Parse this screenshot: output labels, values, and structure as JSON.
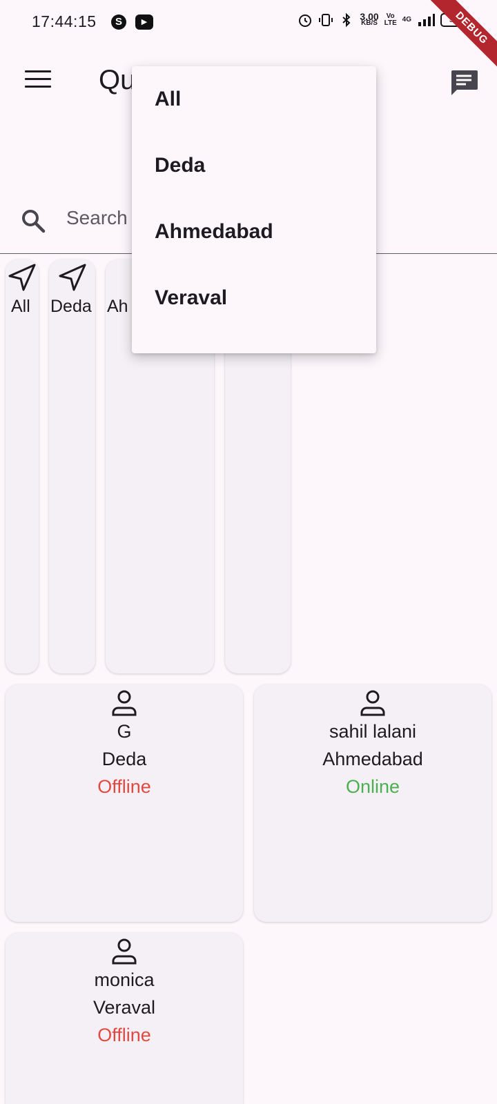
{
  "status_bar": {
    "time": "17:44:15",
    "apps": [
      "S",
      "▶"
    ],
    "speed_value": "3.00",
    "speed_unit": "KB/S",
    "volte": "Vo LTE",
    "network": "4G",
    "battery": "39"
  },
  "debug_banner": "DEBUG",
  "app_bar": {
    "title": "Qu"
  },
  "search": {
    "placeholder": "Search"
  },
  "chips": [
    {
      "label": "All"
    },
    {
      "label": "Deda"
    },
    {
      "label": "Ah"
    },
    {
      "label": ""
    }
  ],
  "users": [
    {
      "name": "G",
      "city": "Deda",
      "status": "Offline"
    },
    {
      "name": "sahil lalani",
      "city": "Ahmedabad",
      "status": "Online"
    },
    {
      "name": "monica",
      "city": "Veraval",
      "status": "Offline"
    }
  ],
  "status_colors": {
    "online": "#4caf50",
    "offline": "#e24a41"
  },
  "dropdown": {
    "items": [
      "All",
      "Deda",
      "Ahmedabad",
      "Veraval"
    ]
  }
}
